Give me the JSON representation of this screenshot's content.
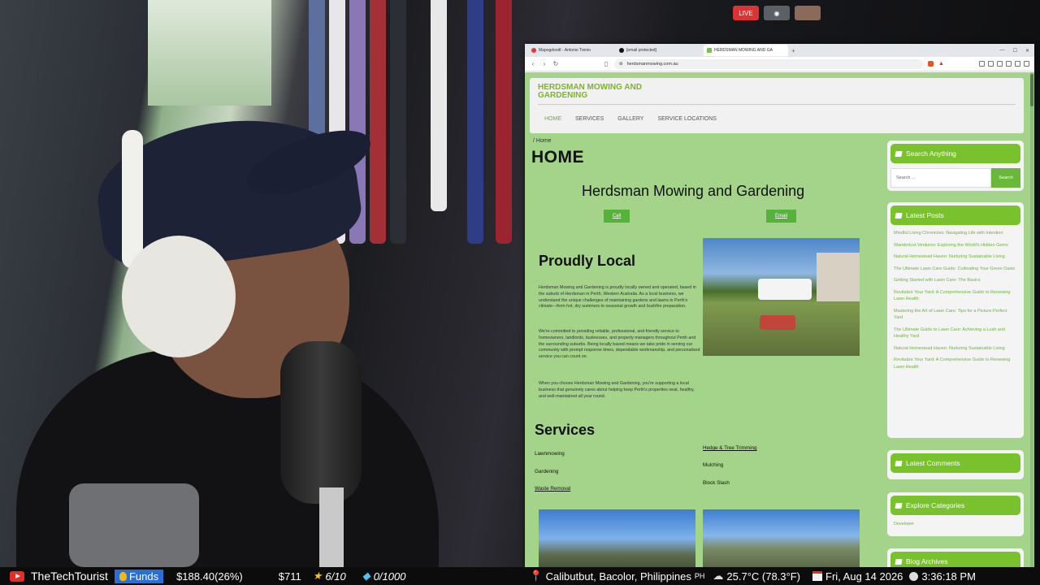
{
  "overlay": {
    "live_badge": "LIVE"
  },
  "browser": {
    "tabs": [
      {
        "label": "Mapogdoodl - Antonio Trenio",
        "active": false
      },
      {
        "label": "[email protected]",
        "active": false
      },
      {
        "label": "HERDSMAN MOWING AND GA",
        "active": true
      }
    ],
    "url": "herdsmanmowing.com.au"
  },
  "site": {
    "title": "HERDSMAN MOWING AND GARDENING",
    "menu": [
      "HOME",
      "SERVICES",
      "GALLERY",
      "SERVICE LOCATIONS"
    ],
    "breadcrumb": "/ Home",
    "page_heading": "HOME",
    "hero_title": "Herdsman Mowing and Gardening",
    "cta_call": "Call",
    "cta_email": "Email",
    "local_heading": "Proudly Local",
    "paragraphs": [
      "Herdsman Mowing and Gardening is proudly locally owned and operated, based in the suburb of Herdsman in Perth, Western Australia. As a local business, we understand the unique challenges of maintaining gardens and lawns in Perth's climate—from hot, dry summers to seasonal growth and bushfire preparation.",
      "We're committed to providing reliable, professional, and friendly service to homeowners, landlords, businesses, and property managers throughout Perth and the surrounding suburbs. Being locally based means we take pride in serving our community with prompt response times, dependable workmanship, and personalised service you can count on.",
      "When you choose Herdsman Mowing and Gardening, you're supporting a local business that genuinely cares about helping keep Perth's properties neat, healthy, and well-maintained all year round."
    ],
    "services_heading": "Services",
    "services_left": [
      "Lawnmowing",
      "Gardening",
      "Waste Removal"
    ],
    "services_right": [
      "Hedge & Tree Trimming",
      "Mulching",
      "Block Slash"
    ]
  },
  "sidebar": {
    "search_title": "Search Anything",
    "search_placeholder": "Search ...",
    "search_button": "Search",
    "latest_posts_title": "Latest Posts",
    "posts": [
      "Mindful Living Chronicles: Navigating Life with Intention",
      "Wanderlust Ventures: Exploring the World's Hidden Gems",
      "Natural Homestead Haven: Nurturing Sustainable Living",
      "The Ultimate Lawn Care Guide: Cultivating Your Green Oasis",
      "Getting Started with Lawn Care: The Basics",
      "Revitalize Your Yard: A Comprehensive Guide to Renewing Lawn Health",
      "Mastering the Art of Lawn Care: Tips for a Picture-Perfect Yard",
      "The Ultimate Guide to Lawn Care: Achieving a Lush and Healthy Yard",
      "Natural Homestead Haven: Nurturing Sustainable Living",
      "Revitalize Your Yard: A Comprehensive Guide to Renewing Lawn Health"
    ],
    "latest_comments_title": "Latest Comments",
    "categories_title": "Explore Categories",
    "categories": [
      "Developer"
    ],
    "archives_title": "Blog Archives"
  },
  "ticker": {
    "channel": "TheTechTourist",
    "funds_label": "Funds",
    "funds_value": "$188.40(26%)",
    "amount": "$711",
    "stars": "6/10",
    "gems": "0/1000",
    "location": "Calibutbut, Bacolor, Philippines",
    "country": "PH",
    "weather": "25.7°C (78.3°F)",
    "date": "Fri, Aug 14 2026",
    "time": "3:36:18 PM"
  }
}
